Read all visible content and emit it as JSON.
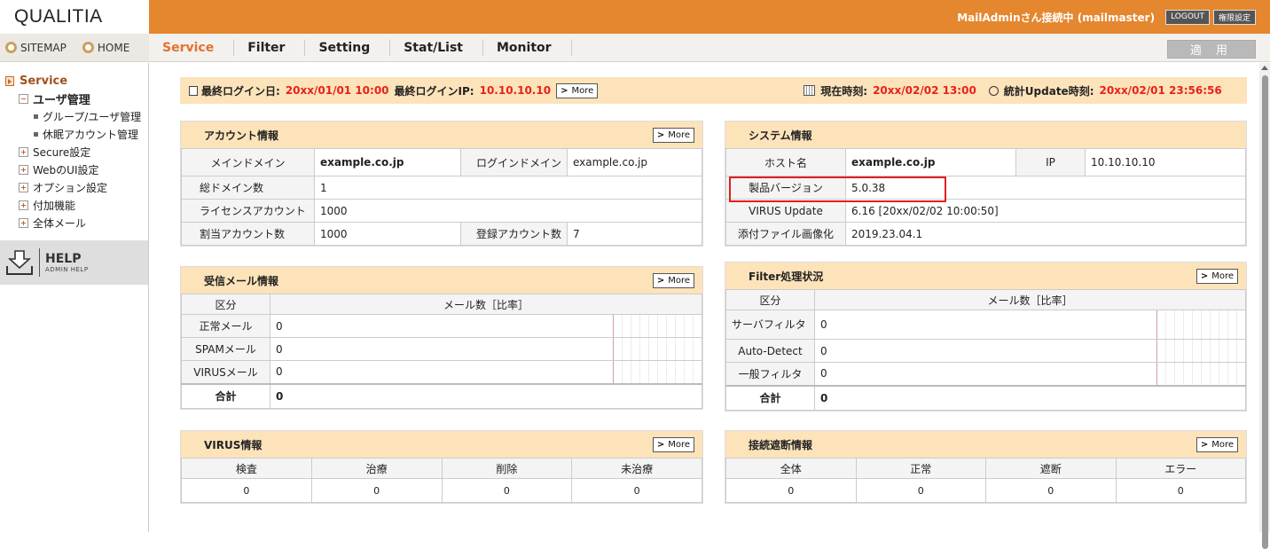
{
  "header": {
    "logo": "QUALITIA",
    "user_status": "MailAdminさん接続中 (mailmaster)",
    "logout": "LOGOUT",
    "permission": "権限設定"
  },
  "leftnav": {
    "sitemap": "SITEMAP",
    "home": "HOME"
  },
  "tabs": [
    "Service",
    "Filter",
    "Setting",
    "Stat/List",
    "Monitor"
  ],
  "apply": "適 用",
  "sidebar": {
    "root": "Service",
    "items": [
      {
        "label": "ユーザ管理",
        "level": 1,
        "expanded": true
      },
      {
        "label": "グループ/ユーザ管理",
        "level": 2
      },
      {
        "label": "休眠アカウント管理",
        "level": 2
      },
      {
        "label": "Secure設定",
        "level": 1
      },
      {
        "label": "WebのUI設定",
        "level": 1
      },
      {
        "label": "オプション設定",
        "level": 1
      },
      {
        "label": "付加機能",
        "level": 1
      },
      {
        "label": "全体メール",
        "level": 1
      }
    ],
    "help_title": "HELP",
    "help_sub": "ADMIN HELP"
  },
  "infobar": {
    "last_login_label": "最終ログイン日:",
    "last_login_value": "20xx/01/01 10:00",
    "last_ip_label": "最終ログインIP:",
    "last_ip_value": "10.10.10.10",
    "more": "More",
    "current_time_label": "現在時刻:",
    "current_time_value": "20xx/02/02 13:00",
    "stat_update_label": "統計Update時刻:",
    "stat_update_value": "20xx/02/01 23:56:56"
  },
  "more": "More",
  "account": {
    "title": "アカウント情報",
    "main_domain_label": "メインドメイン",
    "main_domain": "example.co.jp",
    "login_domain_label": "ログインドメイン",
    "login_domain": "example.co.jp",
    "total_domains_label": "総ドメイン数",
    "total_domains": "1",
    "license_label": "ライセンスアカウント",
    "license": "1000",
    "assigned_label": "割当アカウント数",
    "assigned": "1000",
    "registered_label": "登録アカウント数",
    "registered": "7"
  },
  "system": {
    "title": "システム情報",
    "host_label": "ホスト名",
    "host": "example.co.jp",
    "ip_label": "IP",
    "ip": "10.10.10.10",
    "version_label": "製品バージョン",
    "version": "5.0.38",
    "virus_label": "VIRUS Update",
    "virus": "6.16 [20xx/02/02 10:00:50]",
    "attach_label": "添付ファイル画像化",
    "attach": "2019.23.04.1"
  },
  "received": {
    "title": "受信メール情報",
    "col_category": "区分",
    "col_count": "メール数［比率］",
    "rows": [
      {
        "label": "正常メール",
        "value": "0"
      },
      {
        "label": "SPAMメール",
        "value": "0"
      },
      {
        "label": "VIRUSメール",
        "value": "0"
      }
    ],
    "total_label": "合計",
    "total": "0"
  },
  "filter": {
    "title": "Filter処理状況",
    "col_category": "区分",
    "col_count": "メール数［比率］",
    "rows": [
      {
        "label": "サーバフィルタ",
        "value": "0"
      },
      {
        "label": "Auto-Detect",
        "value": "0"
      },
      {
        "label": "一般フィルタ",
        "value": "0"
      }
    ],
    "total_label": "合計",
    "total": "0"
  },
  "virus": {
    "title": "VIRUS情報",
    "headers": [
      "検査",
      "治療",
      "削除",
      "未治療"
    ],
    "values": [
      "0",
      "0",
      "0",
      "0"
    ]
  },
  "block": {
    "title": "接続遮断情報",
    "headers": [
      "全体",
      "正常",
      "遮断",
      "エラー"
    ],
    "values": [
      "0",
      "0",
      "0",
      "0"
    ]
  }
}
